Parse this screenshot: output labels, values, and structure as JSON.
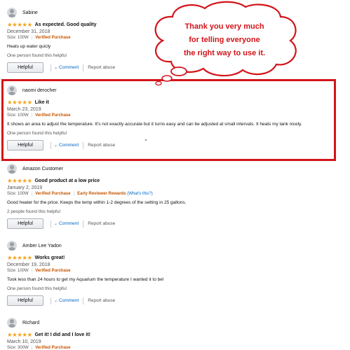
{
  "annotation": {
    "lines": [
      "Thank you very much",
      "for telling everyone",
      "the right way to use it."
    ],
    "color": "#d2141a"
  },
  "reviews": [
    {
      "user": "Sabine",
      "stars": 5,
      "title": "As expected. Good quality",
      "date": "December 31, 2018",
      "size": "Size: 100W",
      "verified": "Verified Purchase",
      "body": "Heats up water quicly",
      "helpful_count": "One person found this helpful"
    },
    {
      "user": "naomi derocher",
      "stars": 5,
      "title": "Like it",
      "date": "March 23, 2019",
      "size": "Size: 100W",
      "verified": "Verified Purchase",
      "body": "It shows an area to adjust the temperature. It's not exactly accurate but it turns easy and can be adjusted at small intervals. It heats my tank nicely.",
      "helpful_count": "One person found this helpful"
    },
    {
      "user": "Amazon Customer",
      "stars": 5,
      "title": "Good product at a low price",
      "date": "January 2, 2019",
      "size": "Size: 100W",
      "verified": "Verified Purchase",
      "badge": "Early Reviewer Rewards",
      "badge_link": "(What's this?)",
      "body": "Good heater for the price. Keeps the temp within 1-2 degrees of the setting in 25 gallons.",
      "helpful_count": "2 people found this helpful"
    },
    {
      "user": "Amber Lee Yadon",
      "stars": 5,
      "title": "Works great!",
      "date": "December 19, 2018",
      "size": "Size: 100W",
      "verified": "Verified Purchase",
      "body": "Took less than 24 hours to get my Aquarium the temperature I wanted it to be!",
      "helpful_count": "One person found this helpful"
    },
    {
      "user": "Richard",
      "stars": 5,
      "title": "Get it! I did and I love it!",
      "date": "March 10, 2019",
      "size": "Size: 300W",
      "verified": "Verified Purchase"
    }
  ],
  "actions": {
    "helpful": "Helpful",
    "comment": "Comment",
    "report": "Report abuse"
  },
  "colors": {
    "star": "#f4a41c",
    "verified": "#c45500",
    "link": "#0066c0",
    "highlight": "#d2141a"
  }
}
